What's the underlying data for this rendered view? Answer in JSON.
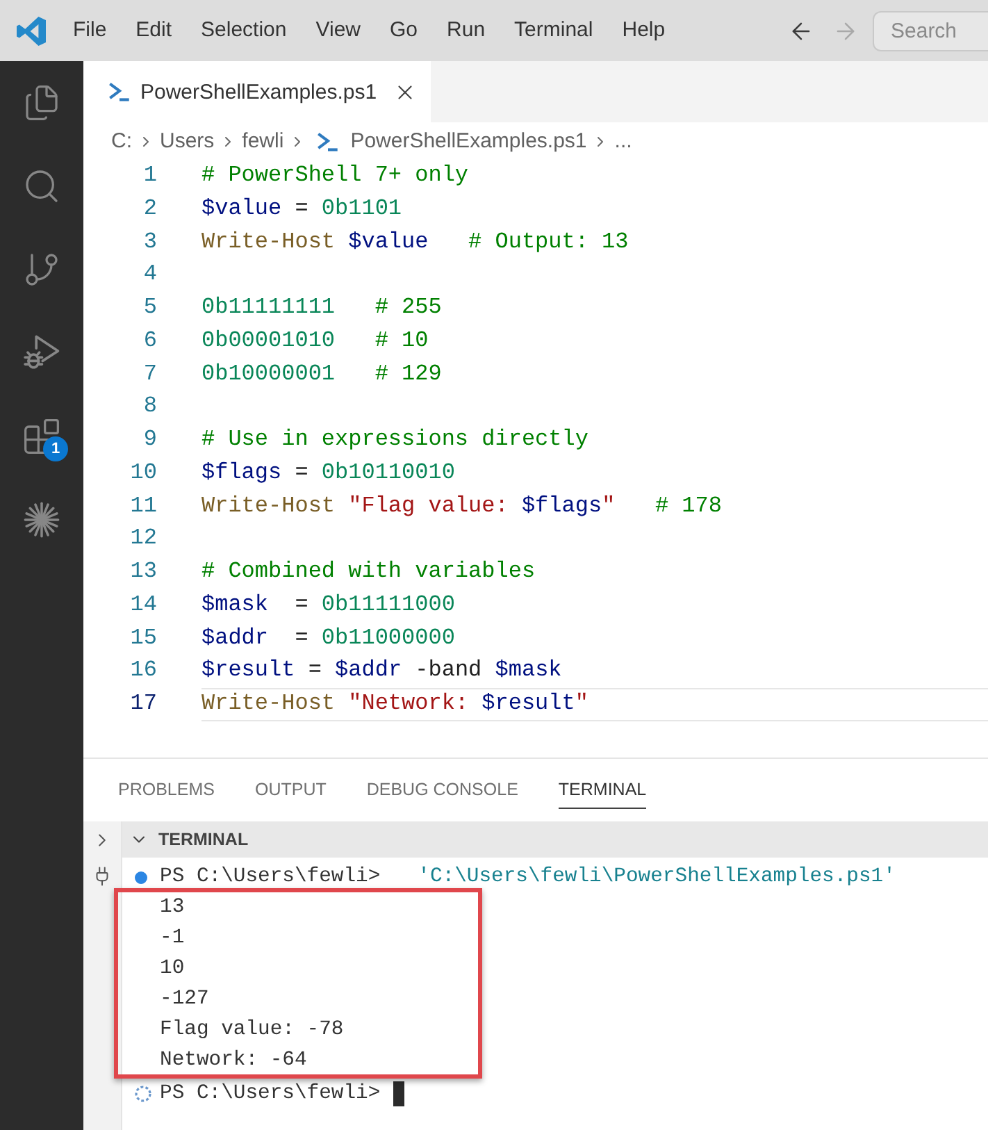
{
  "title_bar": {
    "menu": [
      "File",
      "Edit",
      "Selection",
      "View",
      "Go",
      "Run",
      "Terminal",
      "Help"
    ],
    "navigation": [
      {
        "kind": "back",
        "disabled": false
      },
      {
        "kind": "forward",
        "disabled": true
      }
    ],
    "search": {
      "placeholder": "Search"
    }
  },
  "activity_bar": {
    "extensions_badge": "1"
  },
  "editor": {
    "tabs": [
      {
        "label": "PowerShellExamples.ps1",
        "selected": true
      }
    ],
    "breadcrumb": [
      {
        "kind": "path",
        "label": "C:"
      },
      {
        "kind": "path",
        "label": "Users"
      },
      {
        "kind": "path",
        "label": "fewli"
      },
      {
        "kind": "file",
        "label": "PowerShellExamples.ps1"
      },
      {
        "kind": "path",
        "label": "..."
      }
    ],
    "lines": [
      {
        "number": "1",
        "current": false,
        "tokens": [
          {
            "kind": "comment",
            "text": "# PowerShell 7+ only"
          }
        ]
      },
      {
        "number": "2",
        "current": false,
        "tokens": [
          {
            "kind": "variable",
            "text": "$value"
          },
          {
            "kind": "plain",
            "text": " = "
          },
          {
            "kind": "number",
            "text": "0b1101"
          }
        ]
      },
      {
        "number": "3",
        "current": false,
        "tokens": [
          {
            "kind": "command",
            "text": "Write-Host "
          },
          {
            "kind": "variable",
            "text": "$value"
          },
          {
            "kind": "comment",
            "text": "   # Output: 13"
          }
        ]
      },
      {
        "number": "4",
        "current": false
      },
      {
        "number": "5",
        "current": false,
        "tokens": [
          {
            "kind": "number",
            "text": "0b11111111"
          },
          {
            "kind": "comment",
            "text": "   # 255"
          }
        ]
      },
      {
        "number": "6",
        "current": false,
        "tokens": [
          {
            "kind": "number",
            "text": "0b00001010"
          },
          {
            "kind": "comment",
            "text": "   # 10"
          }
        ]
      },
      {
        "number": "7",
        "current": false,
        "tokens": [
          {
            "kind": "number",
            "text": "0b10000001"
          },
          {
            "kind": "comment",
            "text": "   # 129"
          }
        ]
      },
      {
        "number": "8",
        "current": false
      },
      {
        "number": "9",
        "current": false,
        "tokens": [
          {
            "kind": "comment",
            "text": "# Use in expressions directly"
          }
        ]
      },
      {
        "number": "10",
        "current": false,
        "tokens": [
          {
            "kind": "variable",
            "text": "$flags"
          },
          {
            "kind": "plain",
            "text": " = "
          },
          {
            "kind": "number",
            "text": "0b10110010"
          }
        ]
      },
      {
        "number": "11",
        "current": false,
        "tokens": [
          {
            "kind": "command",
            "text": "Write-Host "
          },
          {
            "kind": "string",
            "text": "\"Flag value: "
          },
          {
            "kind": "variable",
            "text": "$flags"
          },
          {
            "kind": "string",
            "text": "\""
          },
          {
            "kind": "comment",
            "text": "   # 178"
          }
        ]
      },
      {
        "number": "12",
        "current": false
      },
      {
        "number": "13",
        "current": false,
        "tokens": [
          {
            "kind": "comment",
            "text": "# Combined with variables"
          }
        ]
      },
      {
        "number": "14",
        "current": false,
        "tokens": [
          {
            "kind": "variable",
            "text": "$mask"
          },
          {
            "kind": "plain",
            "text": "  = "
          },
          {
            "kind": "number",
            "text": "0b11111000"
          }
        ]
      },
      {
        "number": "15",
        "current": false,
        "tokens": [
          {
            "kind": "variable",
            "text": "$addr"
          },
          {
            "kind": "plain",
            "text": "  = "
          },
          {
            "kind": "number",
            "text": "0b11000000"
          }
        ]
      },
      {
        "number": "16",
        "current": false,
        "tokens": [
          {
            "kind": "variable",
            "text": "$result"
          },
          {
            "kind": "plain",
            "text": " = "
          },
          {
            "kind": "variable",
            "text": "$addr"
          },
          {
            "kind": "plain",
            "text": " -band "
          },
          {
            "kind": "variable",
            "text": "$mask"
          }
        ]
      },
      {
        "number": "17",
        "current": true,
        "tokens": [
          {
            "kind": "command",
            "text": "Write-Host "
          },
          {
            "kind": "string",
            "text": "\"Network: "
          },
          {
            "kind": "variable",
            "text": "$result"
          },
          {
            "kind": "string",
            "text": "\""
          }
        ]
      }
    ]
  },
  "panel": {
    "tabs": [
      {
        "label": "PROBLEMS",
        "selected": false
      },
      {
        "label": "OUTPUT",
        "selected": false
      },
      {
        "label": "DEBUG CONSOLE",
        "selected": false
      },
      {
        "label": "TERMINAL",
        "selected": true
      }
    ],
    "section": {
      "title": "TERMINAL",
      "expanded": true
    },
    "terminal": {
      "lines": [
        {
          "kind": "command",
          "prompt": "PS C:\\Users\\fewli>",
          "command": "'C:\\Users\\fewli\\PowerShellExamples.ps1'",
          "highlighted": false
        },
        {
          "kind": "output",
          "text": "13",
          "highlighted": true
        },
        {
          "kind": "output",
          "text": "-1",
          "highlighted": true
        },
        {
          "kind": "output",
          "text": "10",
          "highlighted": true
        },
        {
          "kind": "output",
          "text": "-127",
          "highlighted": true
        },
        {
          "kind": "output",
          "text": "Flag value: -78",
          "highlighted": true
        },
        {
          "kind": "output",
          "text": "Network: -64",
          "highlighted": true
        },
        {
          "kind": "prompt",
          "prompt": "PS C:\\Users\\fewli>",
          "highlighted": false
        }
      ]
    }
  }
}
